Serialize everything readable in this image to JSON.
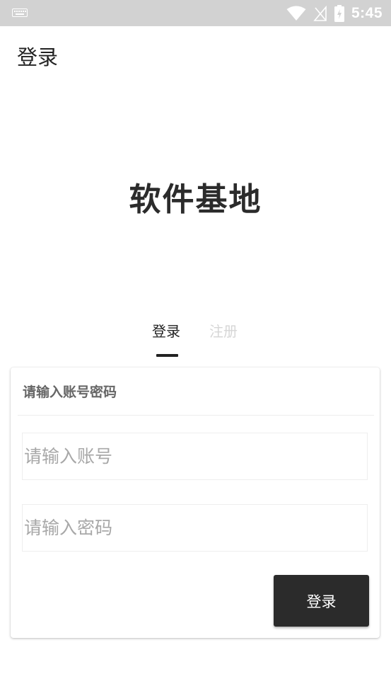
{
  "status_bar": {
    "time": "5:45",
    "icons": [
      "keyboard-icon",
      "wifi-icon",
      "no-signal-icon",
      "battery-charging-icon"
    ]
  },
  "app_bar": {
    "title": "登录"
  },
  "brand": {
    "title": "软件基地"
  },
  "tabs": [
    {
      "label": "登录",
      "active": true
    },
    {
      "label": "注册",
      "active": false
    }
  ],
  "form": {
    "header": "请输入账号密码",
    "account": {
      "placeholder": "请输入账号",
      "value": ""
    },
    "password": {
      "placeholder": "请输入密码",
      "value": ""
    },
    "submit_label": "登录"
  },
  "colors": {
    "status_bar_bg": "#d2d2d2",
    "primary_dark": "#2b2b2b",
    "inactive_tab": "#d6d6d6"
  }
}
